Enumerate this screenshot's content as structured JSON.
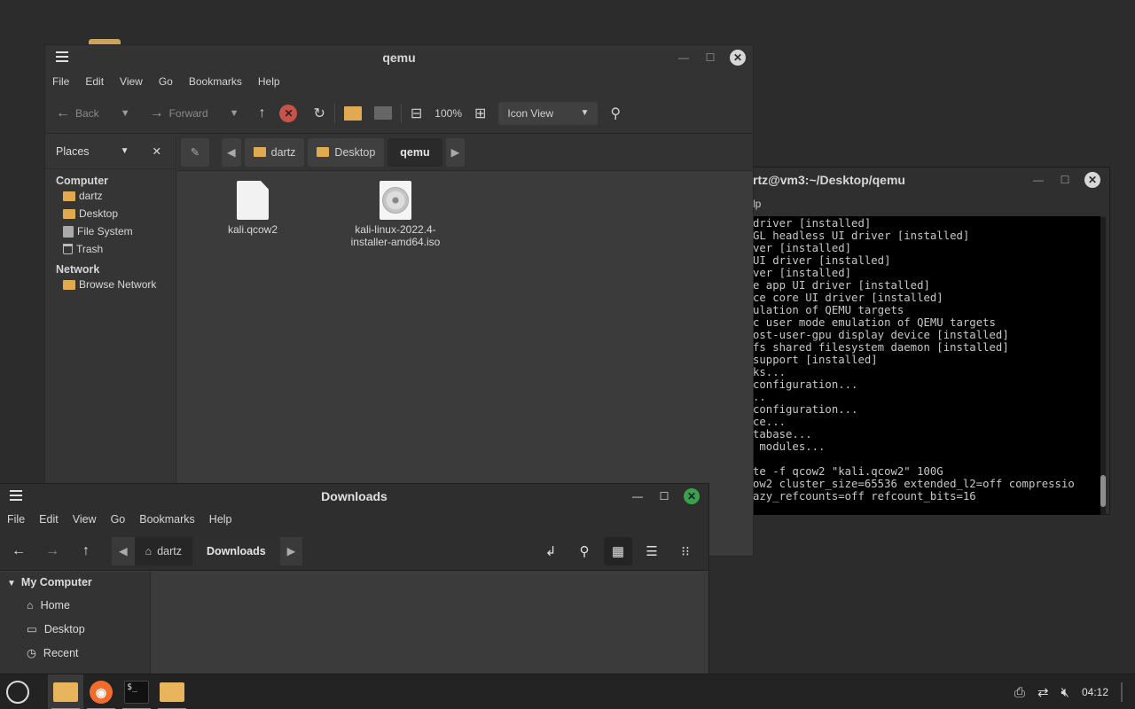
{
  "terminal": {
    "title": "rtz@vm3:~/Desktop/qemu",
    "menu_partial": "lp",
    "lines": [
      "driver [installed]",
      "GL headless UI driver [installed]",
      "ver [installed]",
      "UI driver [installed]",
      "ver [installed]",
      "e app UI driver [installed]",
      "ce core UI driver [installed]",
      "ulation of QEMU targets",
      "c user mode emulation of QEMU targets",
      "ost-user-gpu display device [installed]",
      "fs shared filesystem daemon [installed]",
      "support [installed]",
      "ks...",
      "configuration...",
      "..",
      "configuration...",
      "ce...",
      "tabase...",
      " modules...",
      "",
      "te -f qcow2 \"kali.qcow2\" 100G",
      "ow2 cluster_size=65536 extended_l2=off compressio",
      "azy_refcounts=off refcount_bits=16"
    ]
  },
  "caja": {
    "title": "qemu",
    "menu": [
      "File",
      "Edit",
      "View",
      "Go",
      "Bookmarks",
      "Help"
    ],
    "toolbar": {
      "back": "Back",
      "forward": "Forward",
      "zoom": "100%",
      "view_mode": "Icon View"
    },
    "places_label": "Places",
    "sidebar": {
      "computer_header": "Computer",
      "computer_items": [
        "dartz",
        "Desktop",
        "File System",
        "Trash"
      ],
      "network_header": "Network",
      "network_items": [
        "Browse Network"
      ]
    },
    "path": [
      "dartz",
      "Desktop",
      "qemu"
    ],
    "files": [
      {
        "name": "kali.qcow2",
        "icon": "document-icon"
      },
      {
        "name": "kali-linux-2022.4-installer-amd64.iso",
        "name_line1": "kali-linux-2022.4-",
        "name_line2": "installer-amd64.iso",
        "icon": "disc-image-icon"
      }
    ]
  },
  "nemo": {
    "title": "Downloads",
    "menu": [
      "File",
      "Edit",
      "View",
      "Go",
      "Bookmarks",
      "Help"
    ],
    "path": [
      "dartz",
      "Downloads"
    ],
    "sidebar": {
      "header": "My Computer",
      "items": [
        "Home",
        "Desktop",
        "Recent"
      ]
    }
  },
  "taskbar": {
    "apps": [
      "file-manager",
      "firefox",
      "terminal",
      "file-manager"
    ],
    "clock": "04:12"
  }
}
